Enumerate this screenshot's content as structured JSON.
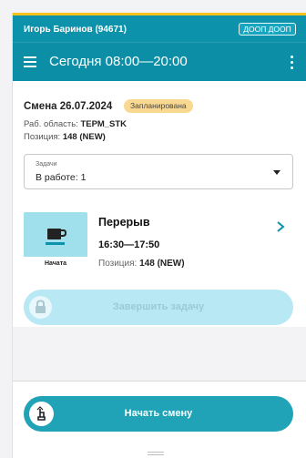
{
  "header": {
    "user_name": "Игорь Баринов (94671)",
    "company_badge": "ДООП ДООП",
    "title": "Сегодня 08:00—20:00"
  },
  "shift": {
    "title": "Смена 26.07.2024",
    "status": "Запланирована",
    "area_label": "Раб. область:",
    "area_value": "ТЕРМ_STK",
    "position_label": "Позиция:",
    "position_value": "148 (NEW)"
  },
  "tasks_select": {
    "label": "Задачи",
    "value": "В работе: 1"
  },
  "task": {
    "title": "Перерыв",
    "time": "16:30—17:50",
    "position_label": "Позиция:",
    "position_value": "148 (NEW)",
    "status": "Начата",
    "icon": "coffee-cup-icon"
  },
  "buttons": {
    "finish_task": "Завершить задачу",
    "start_shift": "Начать смену"
  },
  "colors": {
    "accent": "#0c92ab",
    "badge_yellow": "#f9d892",
    "disabled_button": "#b9e8f5",
    "primary_button": "#20a3b6"
  }
}
